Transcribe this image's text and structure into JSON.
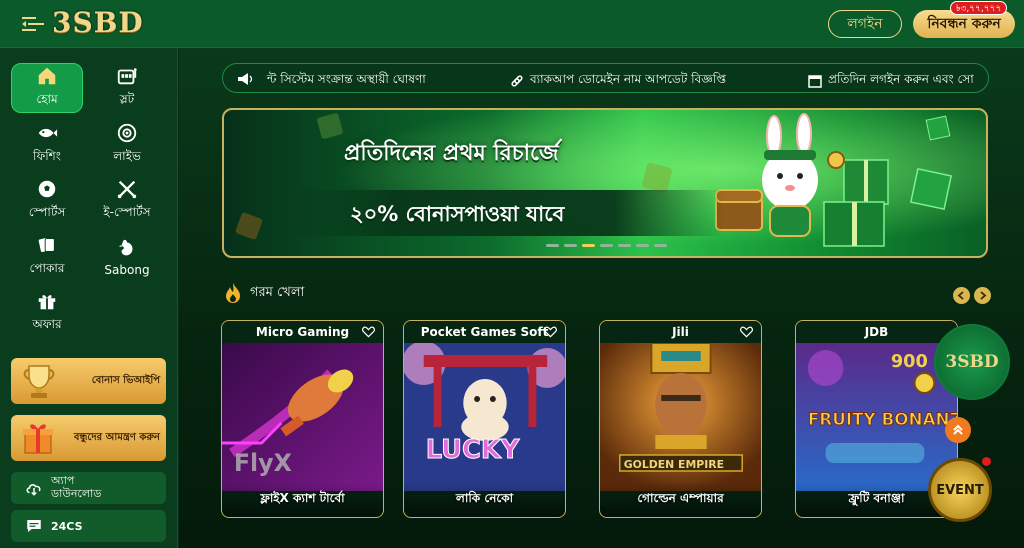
{
  "header": {
    "logo": "3SBD",
    "login_label": "লগইন",
    "register_label": "নিবন্ধন করুন",
    "phone_badge": "৳৩,৭৭,৭৭৭"
  },
  "sidebar": {
    "items": [
      {
        "label": "হোম",
        "icon": "home-icon",
        "active": true
      },
      {
        "label": "স্লট",
        "icon": "slot-machine-icon"
      },
      {
        "label": "ফিশিং",
        "icon": "fish-icon"
      },
      {
        "label": "লাইভ",
        "icon": "live-chip-icon"
      },
      {
        "label": "স্পোর্টস",
        "icon": "soccer-ball-icon"
      },
      {
        "label": "ই-স্পোর্টস",
        "icon": "crossed-swords-icon"
      },
      {
        "label": "পোকার",
        "icon": "cards-icon"
      },
      {
        "label": "Sabong",
        "icon": "rooster-icon"
      },
      {
        "label": "অফার",
        "icon": "gift-icon"
      }
    ],
    "promos": [
      {
        "label": "বোনাস ভিআইপি",
        "icon": "trophy-icon"
      },
      {
        "label": "বন্ধুদের আমন্ত্রণ করুন",
        "icon": "gift-box-icon"
      }
    ],
    "app_download": "অ্যাপ ডাউনলোড",
    "support": "24CS"
  },
  "marquee": {
    "items": [
      "ন্ট সিস্টেম সংক্রান্ত অস্থায়ী ঘোষণা",
      "ব্যাকআপ ডোমেইন নাম আপডেট বিজ্ঞপ্তি",
      "প্রতিদিন লগইন করুন এবং সো"
    ]
  },
  "banner": {
    "line1": "প্রতিদিনের প্রথম রিচার্জে",
    "line2": "২০% বোনাসপাওয়া যাবে",
    "slide_count": 7,
    "active_slide": 3
  },
  "hot_games": {
    "title": "গরম খেলা",
    "games": [
      {
        "provider": "Micro Gaming",
        "name": "ফ্লাইX ক্যাশ টার্বো",
        "art_text": "FlyX"
      },
      {
        "provider": "Pocket Games Soft",
        "name": "লাকি নেকো",
        "art_text": "LUCKY"
      },
      {
        "provider": "Jili",
        "name": "গোল্ডেন এম্পায়ার",
        "art_text": "GOLDEN EMPIRE"
      },
      {
        "provider": "JDB",
        "name": "ফ্রুটি বনাঞ্জা",
        "art_text": "FRUITY BONANZA",
        "art_number": "900"
      }
    ]
  },
  "floating": {
    "logo": "3SBD",
    "event_label": "EVENT"
  },
  "colors": {
    "header_bg": "#0a5a2a",
    "accent_gold": "#f0d68a",
    "active_green": "#139b47",
    "badge_red": "#e01c1c"
  }
}
